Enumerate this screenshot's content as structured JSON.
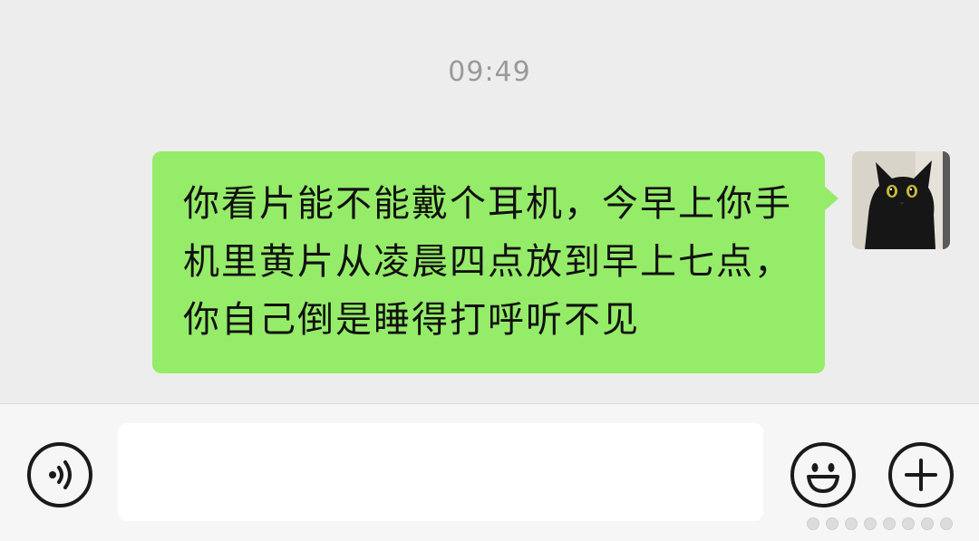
{
  "chat": {
    "timestamp": "09:49",
    "messages": [
      {
        "sender": "self",
        "text": "你看片能不能戴个耳机，今早上你手机里黄片从凌晨四点放到早上七点，你自己倒是睡得打呼听不见"
      }
    ]
  },
  "input_bar": {
    "value": "",
    "placeholder": "",
    "voice_icon": "voice-icon",
    "emoji_icon": "emoji-icon",
    "plus_icon": "plus-icon"
  },
  "colors": {
    "background": "#EDEDED",
    "bubble_self": "#95EC69",
    "input_bar": "#F6F6F6"
  }
}
